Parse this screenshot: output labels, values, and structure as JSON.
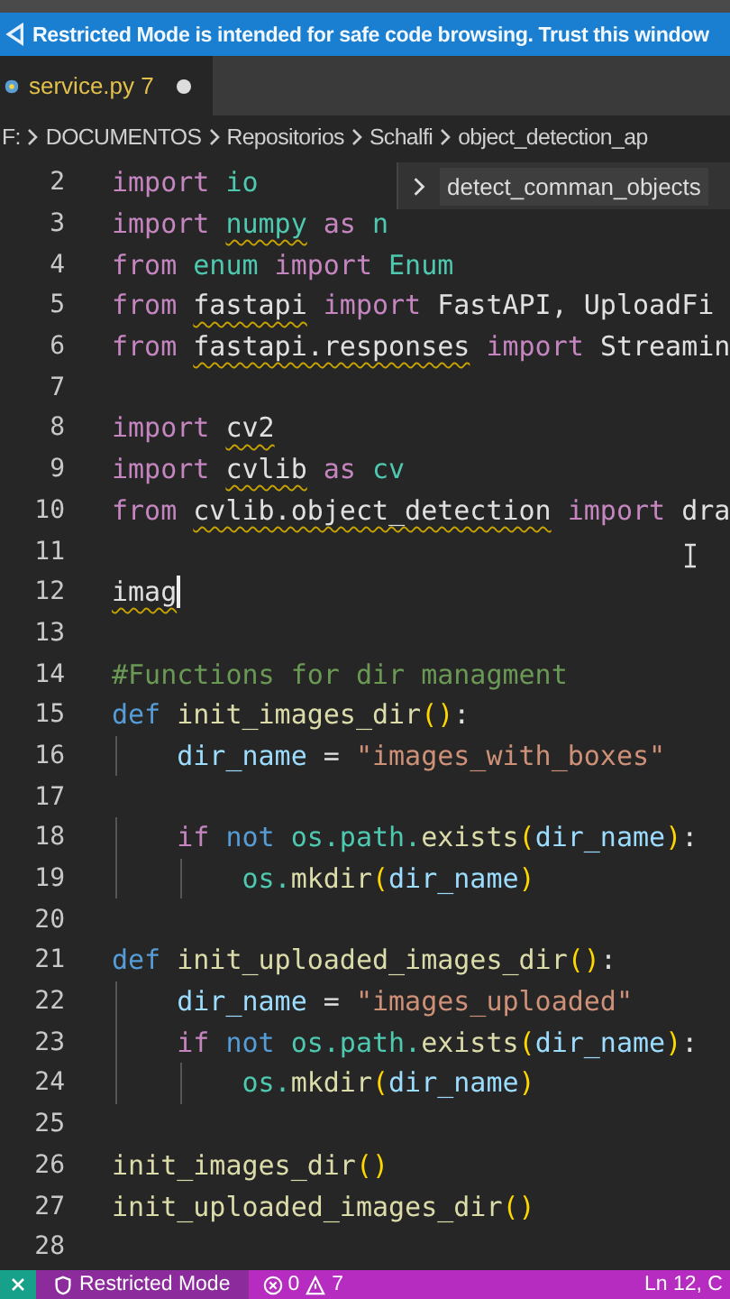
{
  "banner": {
    "text": "Restricted Mode is intended for safe code browsing. Trust this window"
  },
  "tabs": [
    {
      "label": "service.py 7",
      "selected": true,
      "modified": true
    }
  ],
  "breadcrumb": [
    "F:",
    "DOCUMENTOS",
    "Repositorios",
    "Schalfi",
    "object_detection_ap"
  ],
  "sticky_scroll": {
    "label": "detect_comman_objects"
  },
  "code": [
    {
      "n": "2",
      "tokens": [
        {
          "t": "import ",
          "kind": "kw"
        },
        {
          "t": "io",
          "kind": "mod"
        }
      ]
    },
    {
      "n": "3",
      "tokens": [
        {
          "t": "import ",
          "kind": "kw"
        },
        {
          "t": "numpy",
          "kind": "mod",
          "squiggle": true
        },
        {
          "t": " as ",
          "kind": "kw"
        },
        {
          "t": "n",
          "kind": "mod"
        }
      ]
    },
    {
      "n": "4",
      "tokens": [
        {
          "t": "from ",
          "kind": "kw"
        },
        {
          "t": "enum",
          "kind": "mod"
        },
        {
          "t": " import ",
          "kind": "kw"
        },
        {
          "t": "Enum",
          "kind": "mod"
        }
      ]
    },
    {
      "n": "5",
      "tokens": [
        {
          "t": "from ",
          "kind": "kw"
        },
        {
          "t": "fastapi",
          "kind": "plain",
          "squiggle": true
        },
        {
          "t": " import ",
          "kind": "kw"
        },
        {
          "t": "FastAPI, UploadFi",
          "kind": "plain"
        }
      ]
    },
    {
      "n": "6",
      "tokens": [
        {
          "t": "from ",
          "kind": "kw"
        },
        {
          "t": "fastapi.responses",
          "kind": "plain",
          "squiggle": true
        },
        {
          "t": " import ",
          "kind": "kw"
        },
        {
          "t": "Streamin",
          "kind": "plain"
        }
      ]
    },
    {
      "n": "7"
    },
    {
      "n": "8",
      "tokens": [
        {
          "t": "import ",
          "kind": "kw"
        },
        {
          "t": "cv2",
          "kind": "plain",
          "squiggle": true
        }
      ]
    },
    {
      "n": "9",
      "tokens": [
        {
          "t": "import ",
          "kind": "kw"
        },
        {
          "t": "cvlib",
          "kind": "plain",
          "squiggle": true
        },
        {
          "t": " as ",
          "kind": "kw"
        },
        {
          "t": "cv",
          "kind": "mod"
        }
      ]
    },
    {
      "n": "10",
      "tokens": [
        {
          "t": "from ",
          "kind": "kw"
        },
        {
          "t": "cvlib.object_detection",
          "kind": "plain",
          "squiggle": true
        },
        {
          "t": " import ",
          "kind": "kw"
        },
        {
          "t": "dra",
          "kind": "plain"
        }
      ]
    },
    {
      "n": "11"
    },
    {
      "n": "12",
      "cursor": true,
      "tokens": [
        {
          "t": "imag",
          "kind": "plain",
          "squiggle": true
        }
      ]
    },
    {
      "n": "13"
    },
    {
      "n": "14",
      "tokens": [
        {
          "t": "#Functions for dir managment",
          "kind": "comment"
        }
      ]
    },
    {
      "n": "15",
      "tokens": [
        {
          "t": "def ",
          "kind": "def"
        },
        {
          "t": "init_images_dir",
          "kind": "fn"
        },
        {
          "t": "()",
          "kind": "paren"
        },
        {
          "t": ":",
          "kind": "plain"
        }
      ]
    },
    {
      "n": "16",
      "tokens": [
        {
          "t": "    dir_name",
          "kind": "var"
        },
        {
          "t": " = ",
          "kind": "plain"
        },
        {
          "t": "\"images_with_boxes\"",
          "kind": "str"
        }
      ]
    },
    {
      "n": "17"
    },
    {
      "n": "18",
      "tokens": [
        {
          "t": "    if",
          "kind": "kw"
        },
        {
          "t": " not ",
          "kind": "def"
        },
        {
          "t": "os.path.",
          "kind": "mod"
        },
        {
          "t": "exists",
          "kind": "fn"
        },
        {
          "t": "(",
          "kind": "paren"
        },
        {
          "t": "dir_name",
          "kind": "var"
        },
        {
          "t": ")",
          "kind": "paren"
        },
        {
          "t": ":",
          "kind": "plain"
        }
      ]
    },
    {
      "n": "19",
      "tokens": [
        {
          "t": "        os.",
          "kind": "mod"
        },
        {
          "t": "mkdir",
          "kind": "fn"
        },
        {
          "t": "(",
          "kind": "paren"
        },
        {
          "t": "dir_name",
          "kind": "var"
        },
        {
          "t": ")",
          "kind": "paren"
        }
      ]
    },
    {
      "n": "20"
    },
    {
      "n": "21",
      "tokens": [
        {
          "t": "def ",
          "kind": "def"
        },
        {
          "t": "init_uploaded_images_dir",
          "kind": "fn"
        },
        {
          "t": "()",
          "kind": "paren"
        },
        {
          "t": ":",
          "kind": "plain"
        }
      ]
    },
    {
      "n": "22",
      "tokens": [
        {
          "t": "    dir_name",
          "kind": "var"
        },
        {
          "t": " = ",
          "kind": "plain"
        },
        {
          "t": "\"images_uploaded\"",
          "kind": "str"
        }
      ]
    },
    {
      "n": "23",
      "tokens": [
        {
          "t": "    if",
          "kind": "kw"
        },
        {
          "t": " not ",
          "kind": "def"
        },
        {
          "t": "os.path.",
          "kind": "mod"
        },
        {
          "t": "exists",
          "kind": "fn"
        },
        {
          "t": "(",
          "kind": "paren"
        },
        {
          "t": "dir_name",
          "kind": "var"
        },
        {
          "t": ")",
          "kind": "paren"
        },
        {
          "t": ":",
          "kind": "plain"
        }
      ]
    },
    {
      "n": "24",
      "tokens": [
        {
          "t": "        os.",
          "kind": "mod"
        },
        {
          "t": "mkdir",
          "kind": "fn"
        },
        {
          "t": "(",
          "kind": "paren"
        },
        {
          "t": "dir_name",
          "kind": "var"
        },
        {
          "t": ")",
          "kind": "paren"
        }
      ]
    },
    {
      "n": "25"
    },
    {
      "n": "26",
      "tokens": [
        {
          "t": "init_images_dir",
          "kind": "fn"
        },
        {
          "t": "()",
          "kind": "paren"
        }
      ]
    },
    {
      "n": "27",
      "tokens": [
        {
          "t": "init_uploaded_images_dir",
          "kind": "fn"
        },
        {
          "t": "()",
          "kind": "paren"
        }
      ]
    },
    {
      "n": "28"
    }
  ],
  "status_bar": {
    "restricted": "Restricted Mode",
    "errors": "0",
    "warnings": "7",
    "position": "Ln 12, C"
  }
}
